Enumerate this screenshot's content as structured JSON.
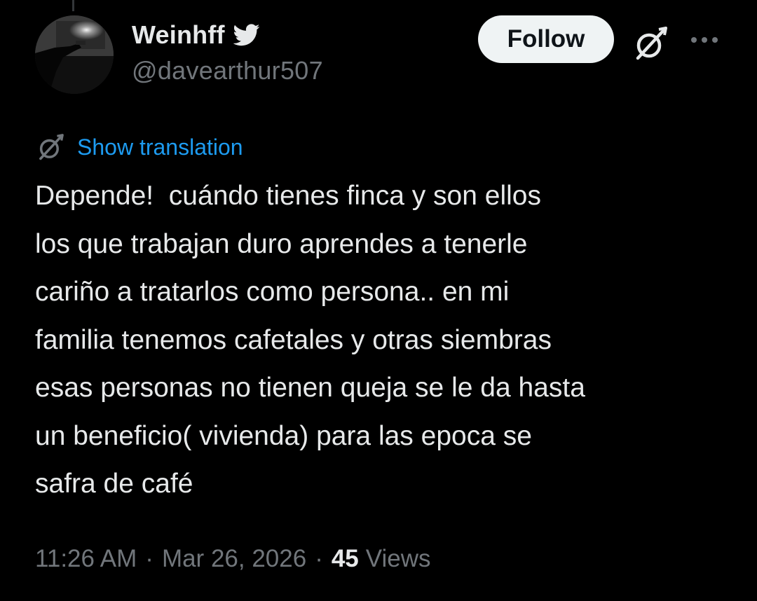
{
  "post": {
    "author": {
      "display_name": "Weinhff",
      "handle": "@davearthur507",
      "verified_badge_icon": "twitter-bird-icon"
    },
    "actions": {
      "follow_label": "Follow",
      "grok_icon": "grok-icon",
      "more_icon": "more-dots-icon"
    },
    "translation": {
      "icon": "grok-icon",
      "link_label": "Show translation"
    },
    "text": "Depende!  cuándo tienes finca y son ellos\nlos que trabajan duro aprendes a tenerle\ncariño a tratarlos como persona.. en mi\nfamilia tenemos cafetales y otras siembras\nesas personas no tienen queja se le da hasta\nun beneficio( vivienda) para las epoca se\nsafra de café",
    "meta": {
      "time": "11:26 AM",
      "separator": "·",
      "date": "Mar 26, 2026",
      "views_count": "45",
      "views_label": "Views"
    }
  },
  "colors": {
    "background": "#000000",
    "primary_text": "#e7e9ea",
    "secondary_text": "#71767b",
    "link": "#1d9bf0",
    "follow_button_bg": "#eff3f4"
  }
}
